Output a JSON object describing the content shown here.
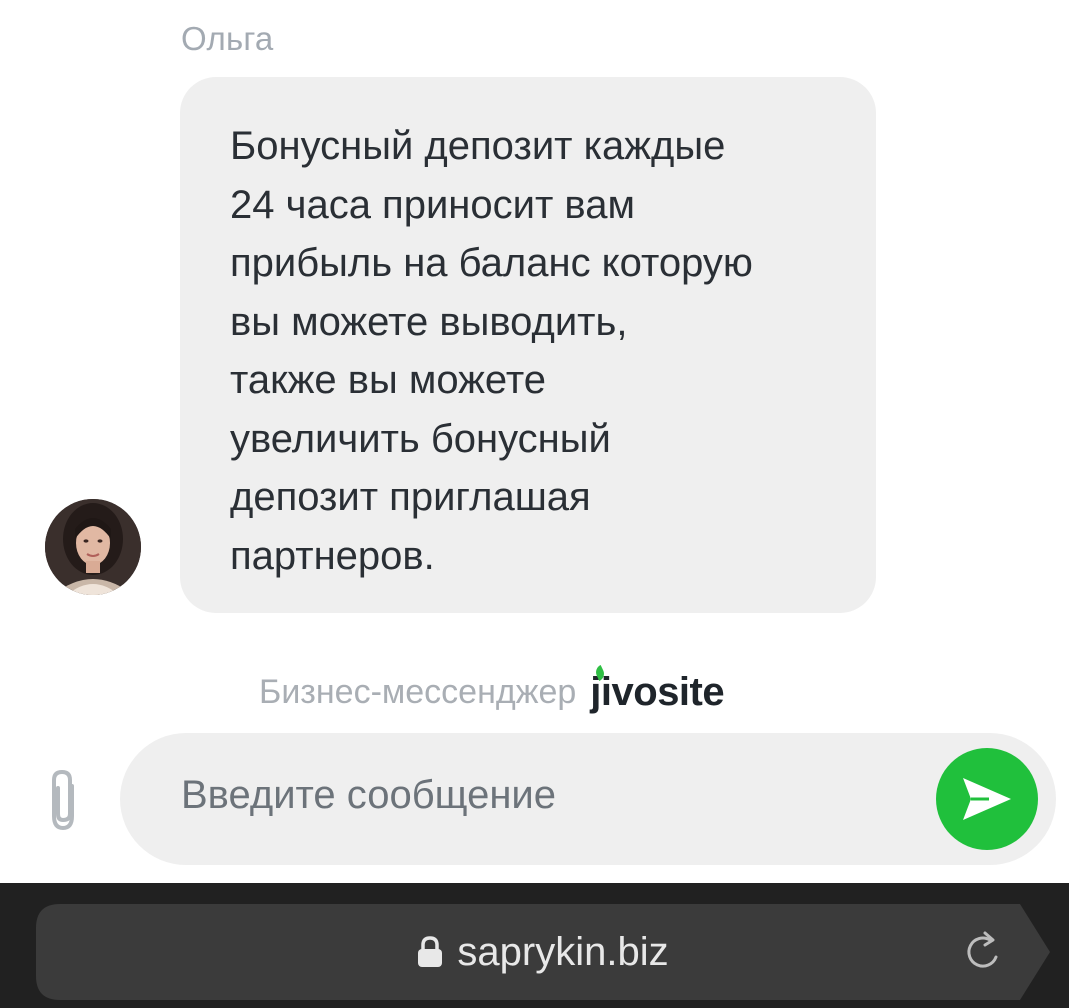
{
  "chat": {
    "sender_name": "Ольга",
    "message": "Бонусный депозит каждые\n24 часа приносит вам\nприбыль на баланс которую\nвы можете выводить,\nтакже вы можете\nувеличить бонусный\nдепозит приглашая\nпартнеров.",
    "avatar_icon": "agent-avatar"
  },
  "branding": {
    "label": "Бизнес-мессенджер",
    "logo": "jivosite",
    "accent": "#2fbf44"
  },
  "composer": {
    "placeholder": "Введите сообщение",
    "attach_icon": "paperclip-icon",
    "send_icon": "send-icon",
    "send_color": "#20c03c"
  },
  "browser": {
    "url": "saprykin.biz",
    "lock_icon": "lock-icon",
    "reload_icon": "reload-icon"
  }
}
